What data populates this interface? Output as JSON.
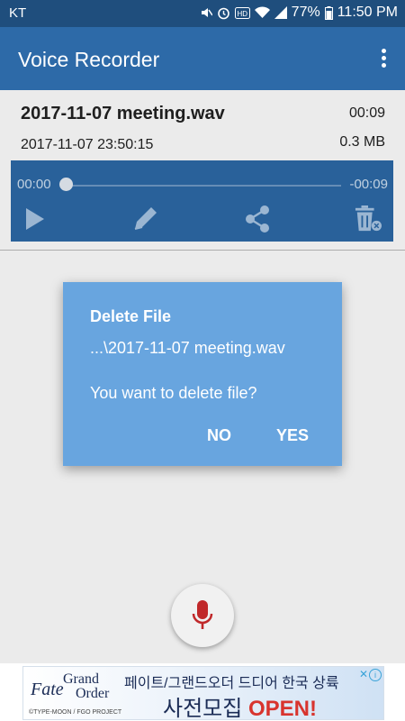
{
  "status_bar": {
    "carrier": "KT",
    "battery": "77%",
    "time": "11:50 PM",
    "icons": [
      "mute-icon",
      "alarm-icon",
      "hd-icon",
      "wifi-icon",
      "signal-icon",
      "battery-icon"
    ]
  },
  "app_bar": {
    "title": "Voice Recorder",
    "menu_icon": "more-vert-icon"
  },
  "recording": {
    "filename": "2017-11-07 meeting.wav",
    "duration": "00:09",
    "datetime": "2017-11-07 23:50:15",
    "size": "0.3 MB"
  },
  "player": {
    "elapsed": "00:00",
    "remaining": "-00:09",
    "progress": 0,
    "controls": [
      "play-icon",
      "edit-icon",
      "share-icon",
      "delete-icon"
    ]
  },
  "dialog": {
    "title": "Delete File",
    "path": "...\\2017-11-07 meeting.wav",
    "message": "You want to delete file?",
    "no_label": "NO",
    "yes_label": "YES"
  },
  "record_button": {
    "icon": "microphone-icon"
  },
  "ad": {
    "brand_fate": "Fate",
    "brand_grand": "Grand",
    "brand_order": "Order",
    "headline": "페이트/그랜드오더 드디어 한국 상륙",
    "sub_prefix": "사전모집",
    "sub_open": "OPEN!",
    "copyright": "©TYPE-MOON / FGO PROJECT"
  },
  "colors": {
    "status_bar": "#1f4e7d",
    "app_bar": "#2d6aa8",
    "dialog": "#68a5df",
    "mic": "#c0282a"
  }
}
